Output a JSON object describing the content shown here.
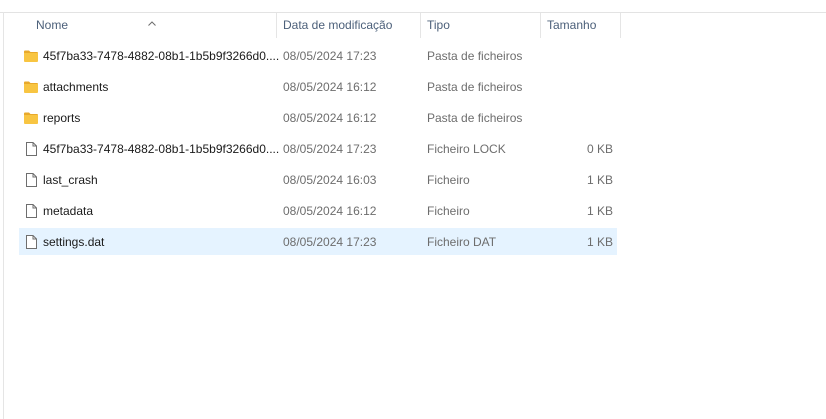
{
  "columns": {
    "name": "Nome",
    "date": "Data de modificação",
    "type": "Tipo",
    "size": "Tamanho"
  },
  "sort": {
    "column": "name",
    "direction": "ascending"
  },
  "files": [
    {
      "name": "45f7ba33-7478-4882-08b1-1b5b9f3266d0....",
      "date": "08/05/2024 17:23",
      "type": "Pasta de ficheiros",
      "size": "",
      "icon": "folder-icon"
    },
    {
      "name": "attachments",
      "date": "08/05/2024 16:12",
      "type": "Pasta de ficheiros",
      "size": "",
      "icon": "folder-icon"
    },
    {
      "name": "reports",
      "date": "08/05/2024 16:12",
      "type": "Pasta de ficheiros",
      "size": "",
      "icon": "folder-icon"
    },
    {
      "name": "45f7ba33-7478-4882-08b1-1b5b9f3266d0....",
      "date": "08/05/2024 17:23",
      "type": "Ficheiro LOCK",
      "size": "0 KB",
      "icon": "file-icon"
    },
    {
      "name": "last_crash",
      "date": "08/05/2024 16:03",
      "type": "Ficheiro",
      "size": "1 KB",
      "icon": "file-icon"
    },
    {
      "name": "metadata",
      "date": "08/05/2024 16:12",
      "type": "Ficheiro",
      "size": "1 KB",
      "icon": "file-icon"
    },
    {
      "name": "settings.dat",
      "date": "08/05/2024 17:23",
      "type": "Ficheiro DAT",
      "size": "1 KB",
      "icon": "file-icon",
      "selected": true
    }
  ],
  "colors": {
    "selection": "#e5f3ff",
    "folder": "#f8c542",
    "header_text": "#4c607a",
    "secondary_text": "#6d6d6d"
  }
}
